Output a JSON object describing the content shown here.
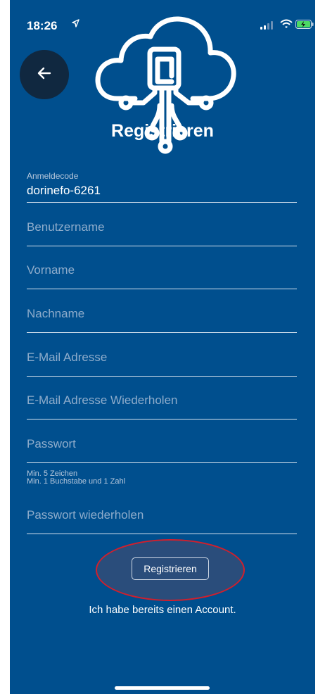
{
  "status_bar": {
    "time": "18:26"
  },
  "title": "Registrieren",
  "form": {
    "login_code_label": "Anmeldecode",
    "login_code_value": "dorinefo-6261",
    "username_placeholder": "Benutzername",
    "firstname_placeholder": "Vorname",
    "lastname_placeholder": "Nachname",
    "email_placeholder": "E-Mail Adresse",
    "email_repeat_placeholder": "E-Mail Adresse Wiederholen",
    "password_placeholder": "Passwort",
    "password_hint_1": "Min. 5 Zeichen",
    "password_hint_2": "Min. 1 Buchstabe und 1 Zahl",
    "password_repeat_placeholder": "Passwort wiederholen"
  },
  "buttons": {
    "register_label": "Registrieren",
    "existing_account_label": "Ich habe bereits einen Account."
  },
  "colors": {
    "background": "#004F8E",
    "back_button": "#102840",
    "annotation_ellipse": "#D21F2C"
  }
}
